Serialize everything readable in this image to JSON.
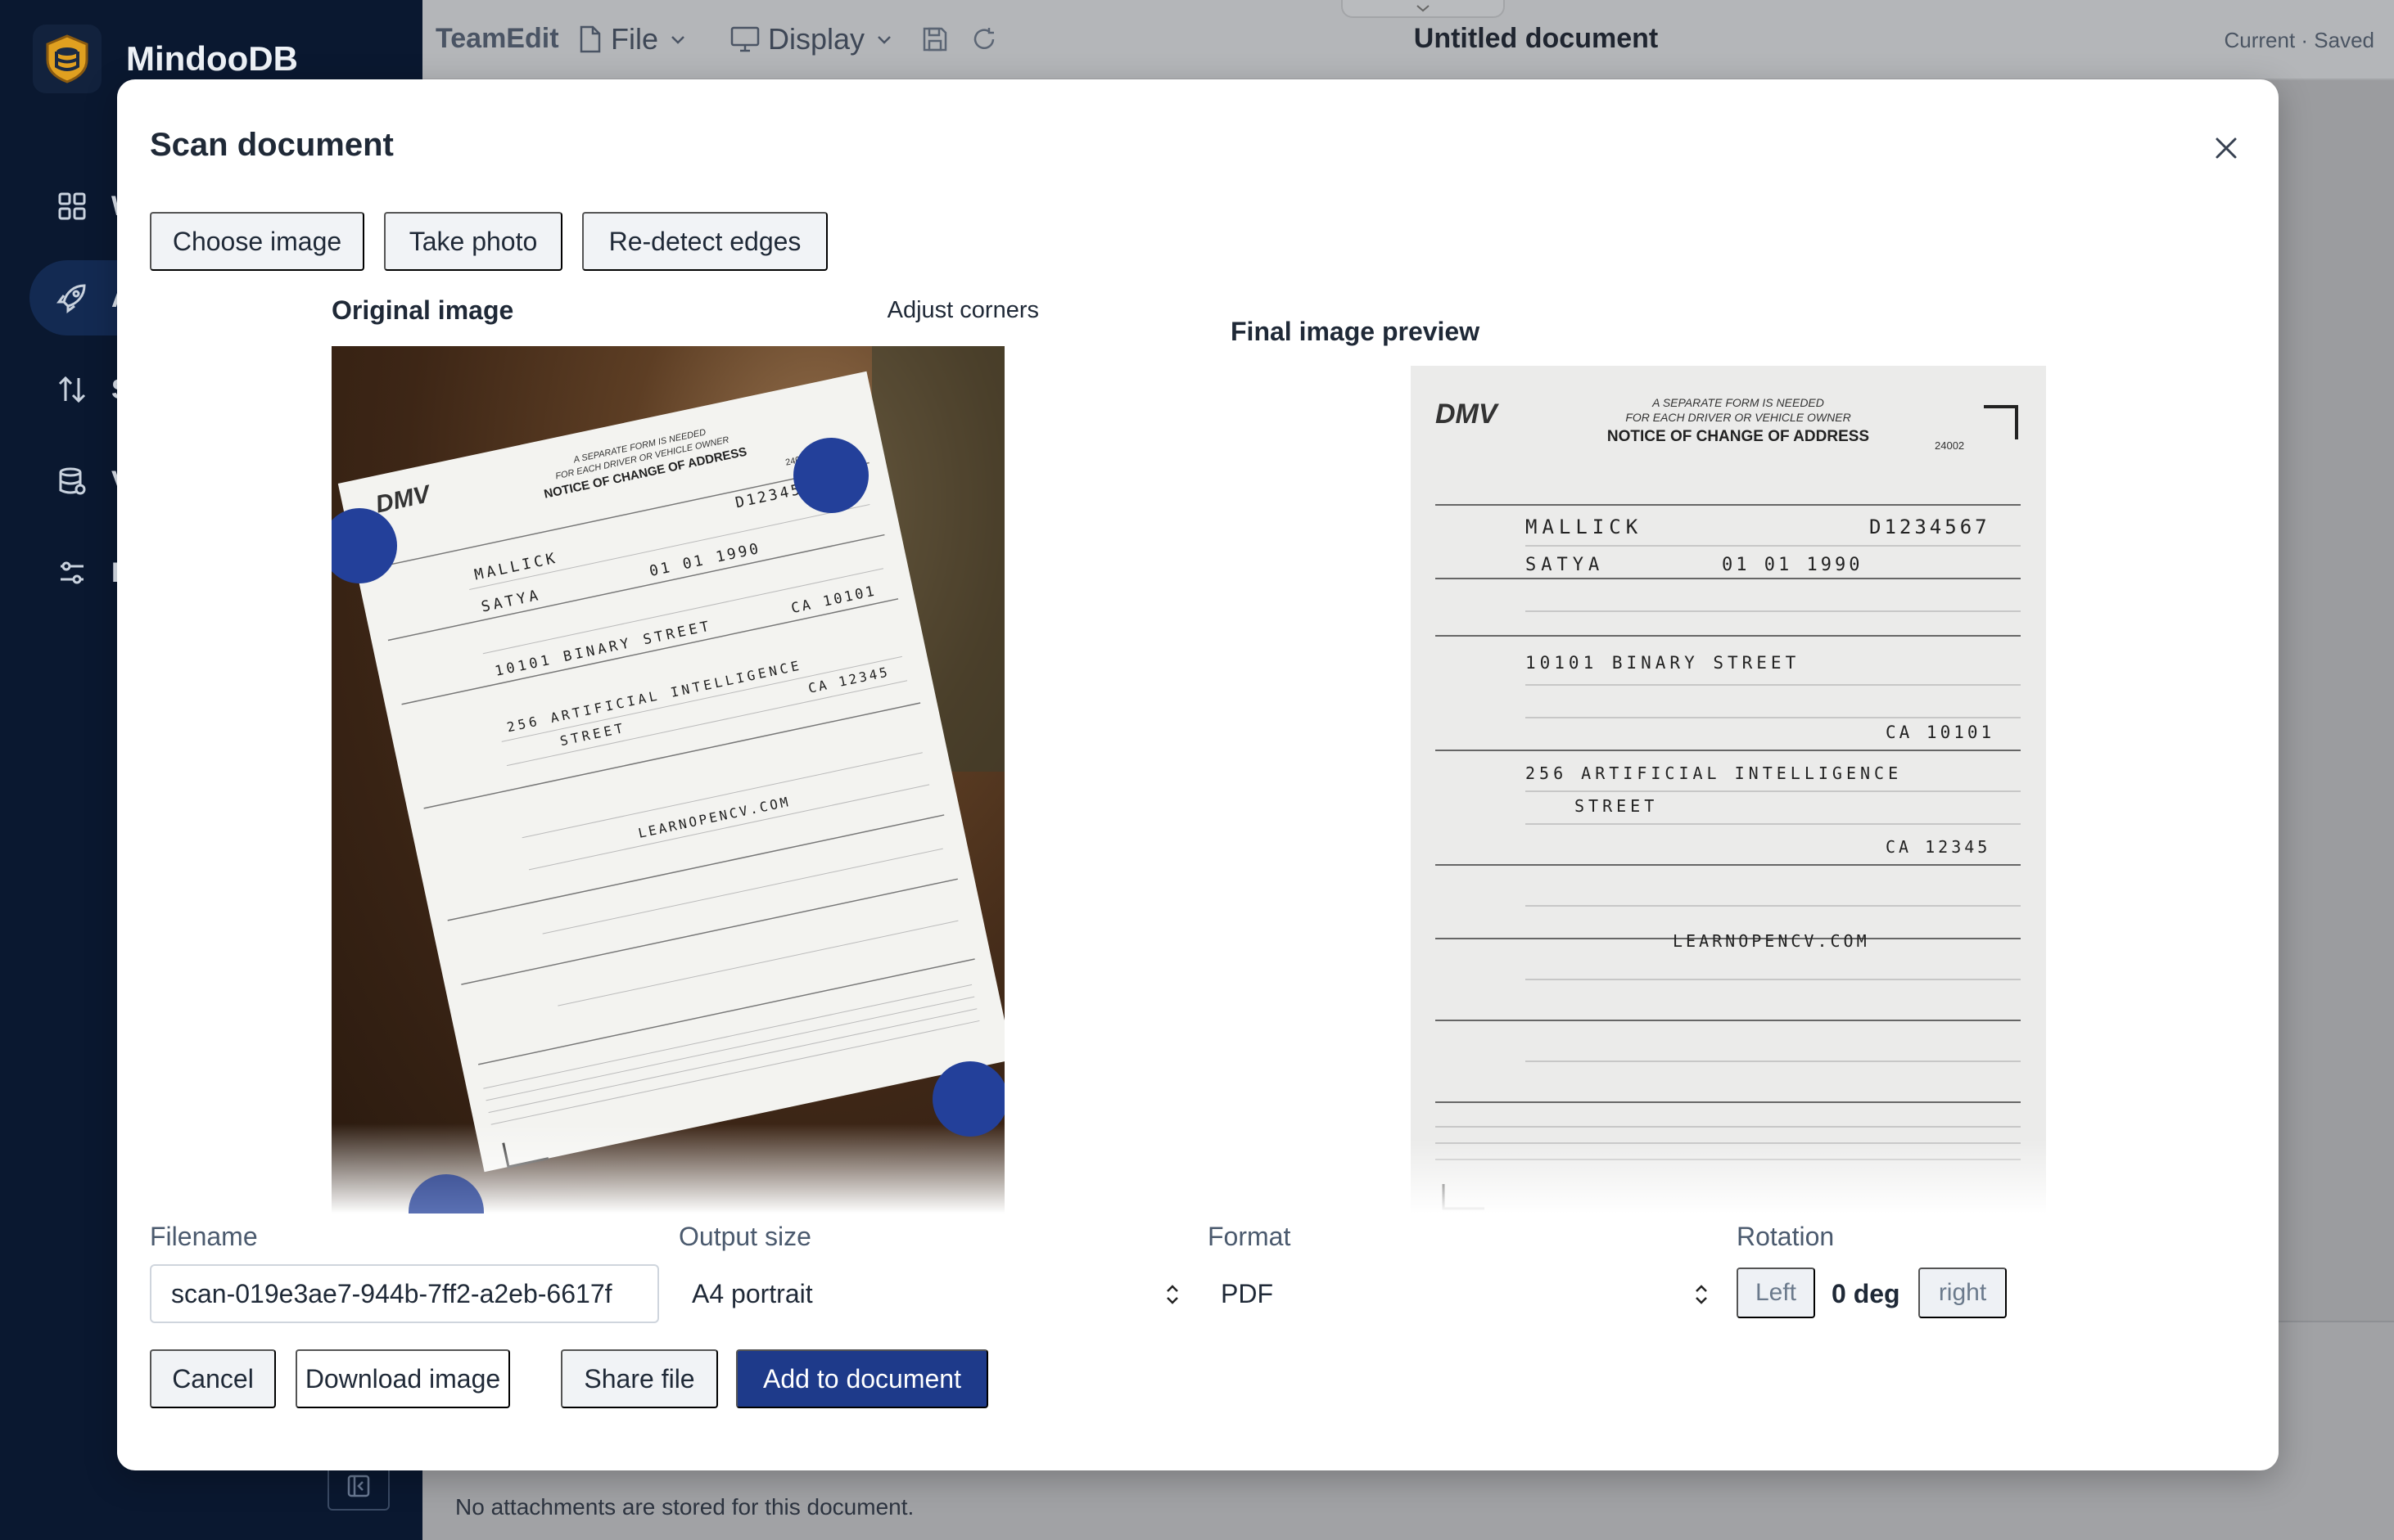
{
  "app": {
    "brand": "MindooDB",
    "sidebar_items": [
      {
        "label": "W",
        "icon": "grid-icon"
      },
      {
        "label": "A",
        "icon": "rocket-icon"
      },
      {
        "label": "S",
        "icon": "sort-arrows-icon"
      },
      {
        "label": "V",
        "icon": "database-icon"
      },
      {
        "label": "P",
        "icon": "sliders-icon"
      }
    ]
  },
  "topbar": {
    "app_name": "TeamEdit",
    "file_menu": "File",
    "display_menu": "Display",
    "document_title": "Untitled document",
    "status": "Current · Saved"
  },
  "background": {
    "attachments_text": "No attachments are stored for this document."
  },
  "modal": {
    "title": "Scan document",
    "buttons": {
      "choose_image": "Choose image",
      "take_photo": "Take photo",
      "redetect_edges": "Re-detect edges"
    },
    "original_heading": "Original image",
    "adjust_corners": "Adjust corners",
    "final_heading": "Final image preview",
    "filename_label": "Filename",
    "filename_value": "scan-019e3ae7-944b-7ff2-a2eb-6617f",
    "output_size_label": "Output size",
    "output_size_value": "A4 portrait",
    "format_label": "Format",
    "format_value": "PDF",
    "rotation_label": "Rotation",
    "rotation_left": "Left",
    "rotation_value": "0 deg",
    "rotation_right": "right",
    "actions": {
      "cancel": "Cancel",
      "download": "Download image",
      "share": "Share file",
      "add": "Add to document"
    }
  },
  "scanned_form": {
    "agency": "DMV",
    "header_line1": "A SEPARATE FORM IS NEEDED",
    "header_line2": "FOR EACH DRIVER OR VEHICLE OWNER",
    "form_title": "NOTICE OF CHANGE OF ADDRESS",
    "form_code": "24002",
    "last_name": "MALLICK",
    "license_no": "D1234567",
    "first_name": "SATYA",
    "birth_date": "01  01  1990",
    "street": "10101  BINARY  STREET",
    "state_zip_1": "CA  10101",
    "mail_street_1": "256  ARTIFICIAL  INTELLIGENCE",
    "mail_street_2": "STREET",
    "state_zip_2": "CA  12345",
    "vehicle_line": "LEARNOPENCV.COM"
  },
  "colors": {
    "primary": "#1e3a8a",
    "corner_handle": "#23409a",
    "sidebar": "#0a1830"
  }
}
